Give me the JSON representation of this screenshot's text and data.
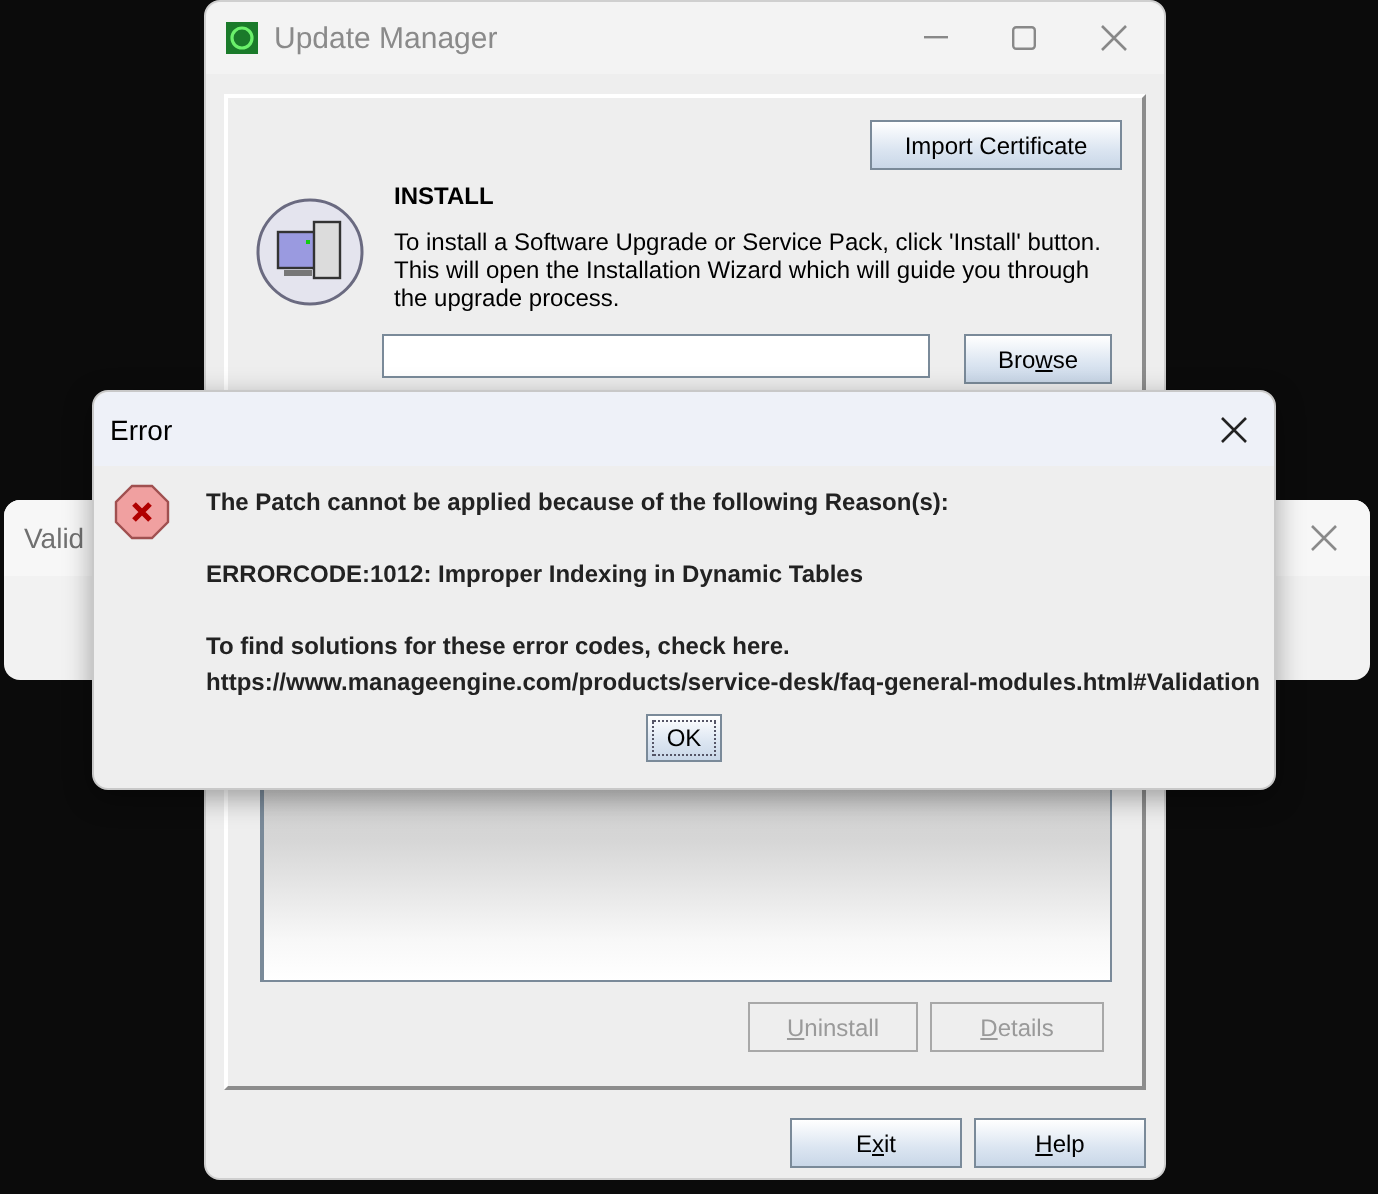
{
  "background_window": {
    "title": "Valid"
  },
  "main_window": {
    "title": "Update Manager",
    "import_button": {
      "label_start": "Import Certificate",
      "disabled": false
    },
    "section_title": "INSTALL",
    "description": "To install a Software Upgrade or Service Pack, click 'Install' button. This will open the Installation Wizard which will guide you through the upgrade process.",
    "browse_button": {
      "label_start": "Bro",
      "mnemonic": "w",
      "label_end": "se",
      "disabled": false
    },
    "list_buttons": [
      {
        "mnemonic": "U",
        "label_end": "ninstall",
        "disabled": true
      },
      {
        "mnemonic": "D",
        "label_end": "etails",
        "disabled": true
      }
    ],
    "footer_buttons": [
      {
        "label_start": "E",
        "mnemonic": "x",
        "label_end": "it",
        "disabled": false
      },
      {
        "mnemonic": "H",
        "label_end": "elp",
        "disabled": false
      }
    ]
  },
  "error_dialog": {
    "title": "Error",
    "paragraphs": [
      [
        "The Patch cannot be applied because of the following Reason(s):"
      ],
      [
        "ERRORCODE:1012: Improper Indexing in Dynamic Tables"
      ],
      [
        "To find solutions for these error codes, check here.",
        "https://www.manageengine.com/products/service-desk/faq-general-modules.html#Validation"
      ]
    ],
    "ok_button": {
      "label_start": "OK",
      "disabled": false
    }
  }
}
